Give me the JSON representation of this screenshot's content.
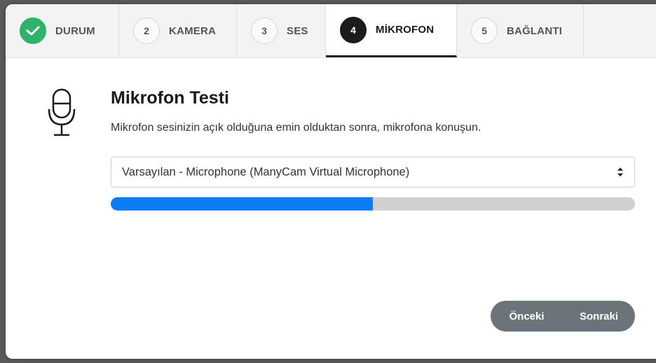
{
  "tabs": [
    {
      "step": "",
      "label": "DURUM",
      "state": "done"
    },
    {
      "step": "2",
      "label": "KAMERA",
      "state": "pending"
    },
    {
      "step": "3",
      "label": "SES",
      "state": "pending"
    },
    {
      "step": "4",
      "label": "MİKROFON",
      "state": "current"
    },
    {
      "step": "5",
      "label": "BAĞLANTI",
      "state": "pending"
    }
  ],
  "main": {
    "icon": "microphone-icon",
    "title": "Mikrofon Testi",
    "subtitle": "Mikrofon sesinizin açık olduğuna emin olduktan sonra, mikrofona konuşun.",
    "device_select": {
      "selected": "Varsayılan - Microphone (ManyCam Virtual Microphone)"
    },
    "level_meter": {
      "level_percent": 50
    }
  },
  "footer": {
    "prev_label": "Önceki",
    "next_label": "Sonraki"
  },
  "colors": {
    "done": "#2fb36b",
    "current": "#1c1c1c",
    "meter_fill": "#0a7cf4",
    "meter_track": "#d0d0d0",
    "nav_button": "#6b7479"
  }
}
